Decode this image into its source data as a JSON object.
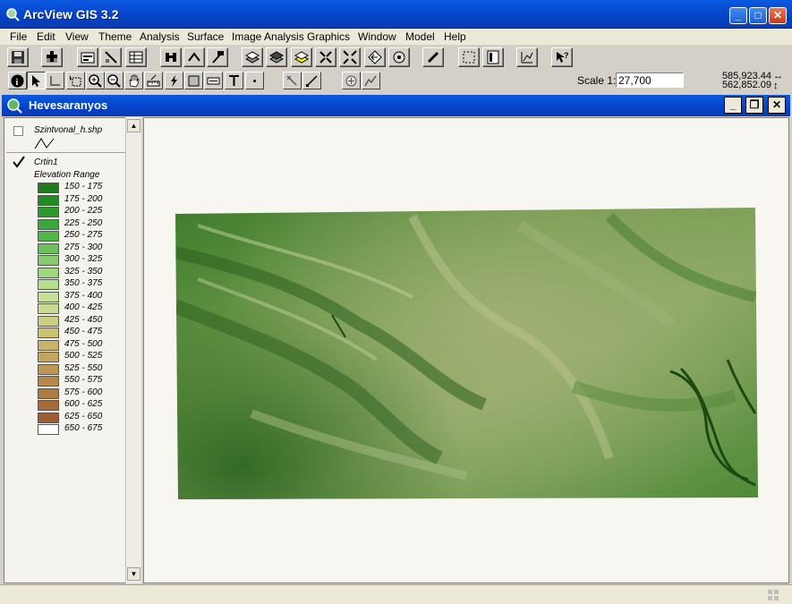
{
  "app": {
    "title": "ArcView GIS 3.2"
  },
  "window_buttons": {
    "minimize": "_",
    "maximize": "□",
    "close": "✕"
  },
  "menu": [
    "File",
    "Edit",
    "View",
    "Theme",
    "Analysis",
    "Surface",
    "Image Analysis",
    "Graphics",
    "Window",
    "Model",
    "Help"
  ],
  "toolbar": {
    "scale_label": "Scale 1:",
    "scale_value": "27,700",
    "coord_x": "585,923.44",
    "coord_y": "562,852.09",
    "coord_x_arrow": "↔",
    "coord_y_arrow": "↕"
  },
  "view": {
    "title": "Hevesaranyos",
    "buttons": {
      "minimize": "_",
      "restore": "❐",
      "close": "✕"
    }
  },
  "toc": {
    "themes": [
      {
        "name": "Szintvonal_h.shp",
        "checked": false
      },
      {
        "name": "Crtin1",
        "checked": true,
        "legend_title": "Elevation Range"
      }
    ],
    "legend": [
      {
        "label": "150 - 175",
        "color": "#1f7a1f"
      },
      {
        "label": "175 - 200",
        "color": "#218a21"
      },
      {
        "label": "200 - 225",
        "color": "#2a9a2a"
      },
      {
        "label": "225 - 250",
        "color": "#3aa83a"
      },
      {
        "label": "250 - 275",
        "color": "#52b548"
      },
      {
        "label": "275 - 300",
        "color": "#6cc25a"
      },
      {
        "label": "300 - 325",
        "color": "#86cc6c"
      },
      {
        "label": "325 - 350",
        "color": "#a0d67e"
      },
      {
        "label": "350 - 375",
        "color": "#b6df8c"
      },
      {
        "label": "375 - 400",
        "color": "#c4e296"
      },
      {
        "label": "400 - 425",
        "color": "#c9db8e"
      },
      {
        "label": "425 - 450",
        "color": "#cbcf80"
      },
      {
        "label": "450 - 475",
        "color": "#cbc272"
      },
      {
        "label": "475 - 500",
        "color": "#c8b466"
      },
      {
        "label": "500 - 525",
        "color": "#c4a55c"
      },
      {
        "label": "525 - 550",
        "color": "#bd9652"
      },
      {
        "label": "550 - 575",
        "color": "#b5884a"
      },
      {
        "label": "575 - 600",
        "color": "#ad7a42"
      },
      {
        "label": "600 - 625",
        "color": "#a56c3a"
      },
      {
        "label": "625 - 650",
        "color": "#9c5e32"
      },
      {
        "label": "650 - 675",
        "color": "#ffffff"
      }
    ]
  },
  "status": {
    "text": ""
  },
  "colors": {
    "titlebar": "#0542c8",
    "map_background": "#f7f6f1",
    "terrain_dark": "#2f6a22",
    "terrain_light": "#8fae62"
  }
}
